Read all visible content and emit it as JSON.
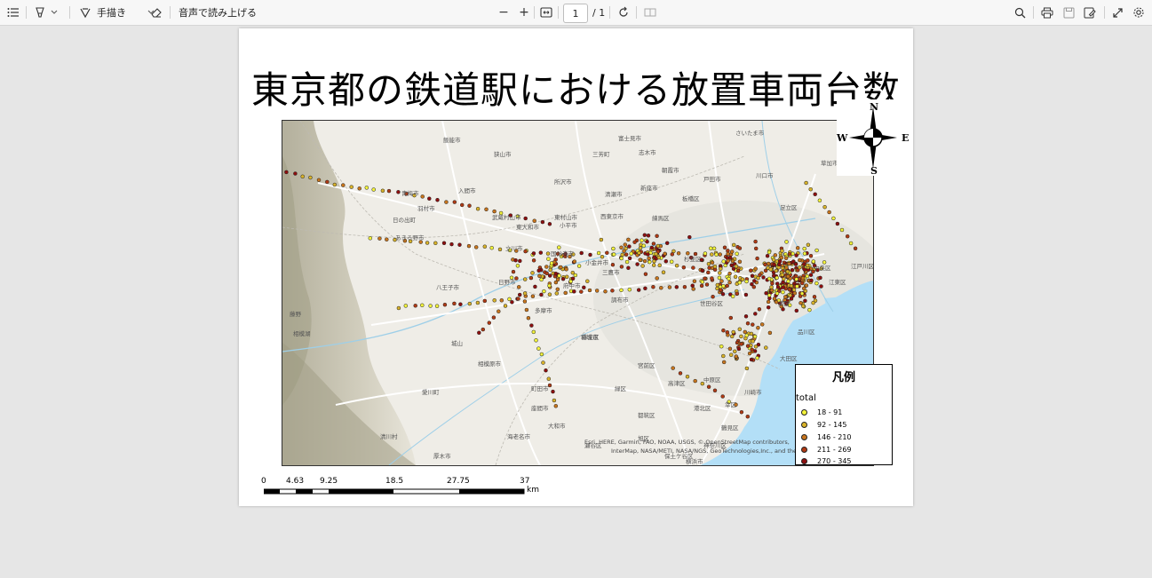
{
  "toolbar": {
    "draw_label": "手描き",
    "read_aloud_label": "音声で読み上げる",
    "page_current": "1",
    "page_total": "/ 1",
    "zoom_out": "−",
    "zoom_in": "+"
  },
  "document": {
    "title": "東京都の鉄道駅における放置車両台数"
  },
  "map": {
    "compass": {
      "n": "N",
      "s": "S",
      "e": "E",
      "w": "W"
    },
    "attribution_1": "Esri, HERE, Garmin, FAO, NOAA, USGS, © OpenStreetMap contributors,",
    "attribution_2": "InterMap, NASA/METI, NASA/NGS, GeoTechnologies,Inc., and the",
    "places": {
      "p1": "さいたま市",
      "p2": "川口市",
      "p3": "草加市",
      "p4": "所沢市",
      "p5": "青梅市",
      "p6": "羽村市",
      "p7": "八王子市",
      "p8": "日野市",
      "p9": "府中市",
      "p10": "国分寺市",
      "p11": "相模原市",
      "p12": "町田市",
      "p13": "大和市",
      "p14": "横浜市",
      "p15": "川崎市",
      "p16": "江東区",
      "p17": "品川区",
      "p18": "大田区",
      "p19": "世田谷区",
      "p20": "杉並区",
      "p21": "練馬区",
      "p22": "板橋区",
      "p23": "足立区",
      "p24": "立川市",
      "p25": "三鷹市",
      "p26": "調布市",
      "p27": "多摩市",
      "p28": "稲城市",
      "p29": "東大和市",
      "p30": "武蔵村山市",
      "p31": "あきる野市",
      "p32": "日の出町",
      "p33": "飯能市",
      "p34": "入間市",
      "p35": "狭山市",
      "p36": "新座市",
      "p37": "朝霞市",
      "p38": "戸田市",
      "p39": "港区",
      "p40": "中央区",
      "p41": "清瀬市",
      "p42": "西東京市",
      "p43": "小金井市",
      "p44": "小平市",
      "p45": "東村山市",
      "p46": "富士見市",
      "p47": "三芳町",
      "p48": "志木市",
      "p49": "厚木市",
      "p50": "海老名市",
      "p51": "座間市",
      "p52": "清川村",
      "p53": "愛川町",
      "p54": "城山",
      "p55": "緑区",
      "p56": "麻生区",
      "p57": "宮前区",
      "p58": "都筑区",
      "p59": "港北区",
      "p60": "中原区",
      "p61": "高津区",
      "p62": "幸区",
      "p63": "鶴見区",
      "p64": "神奈川区",
      "p65": "瀬谷区",
      "p66": "旭区",
      "p67": "保土ケ谷区",
      "p68": "相模湖",
      "p69": "藤野",
      "p70": "江戸川区"
    }
  },
  "legend": {
    "title": "凡例",
    "field": "total",
    "classes": [
      {
        "label": "18 - 91",
        "color": "#f3f33a"
      },
      {
        "label": "92 - 145",
        "color": "#d9b32a"
      },
      {
        "label": "146 - 210",
        "color": "#c8751d"
      },
      {
        "label": "211 - 269",
        "color": "#b03a14"
      },
      {
        "label": "270 - 345",
        "color": "#8e0f0f"
      }
    ]
  },
  "scalebar": {
    "ticks": [
      "0",
      "4.63",
      "9.25",
      "18.5",
      "27.75",
      "37"
    ],
    "unit": "km"
  },
  "colors": {
    "water": "#b3dff7",
    "map_land": "#eeece6",
    "mountain": "#bdb9a6"
  }
}
